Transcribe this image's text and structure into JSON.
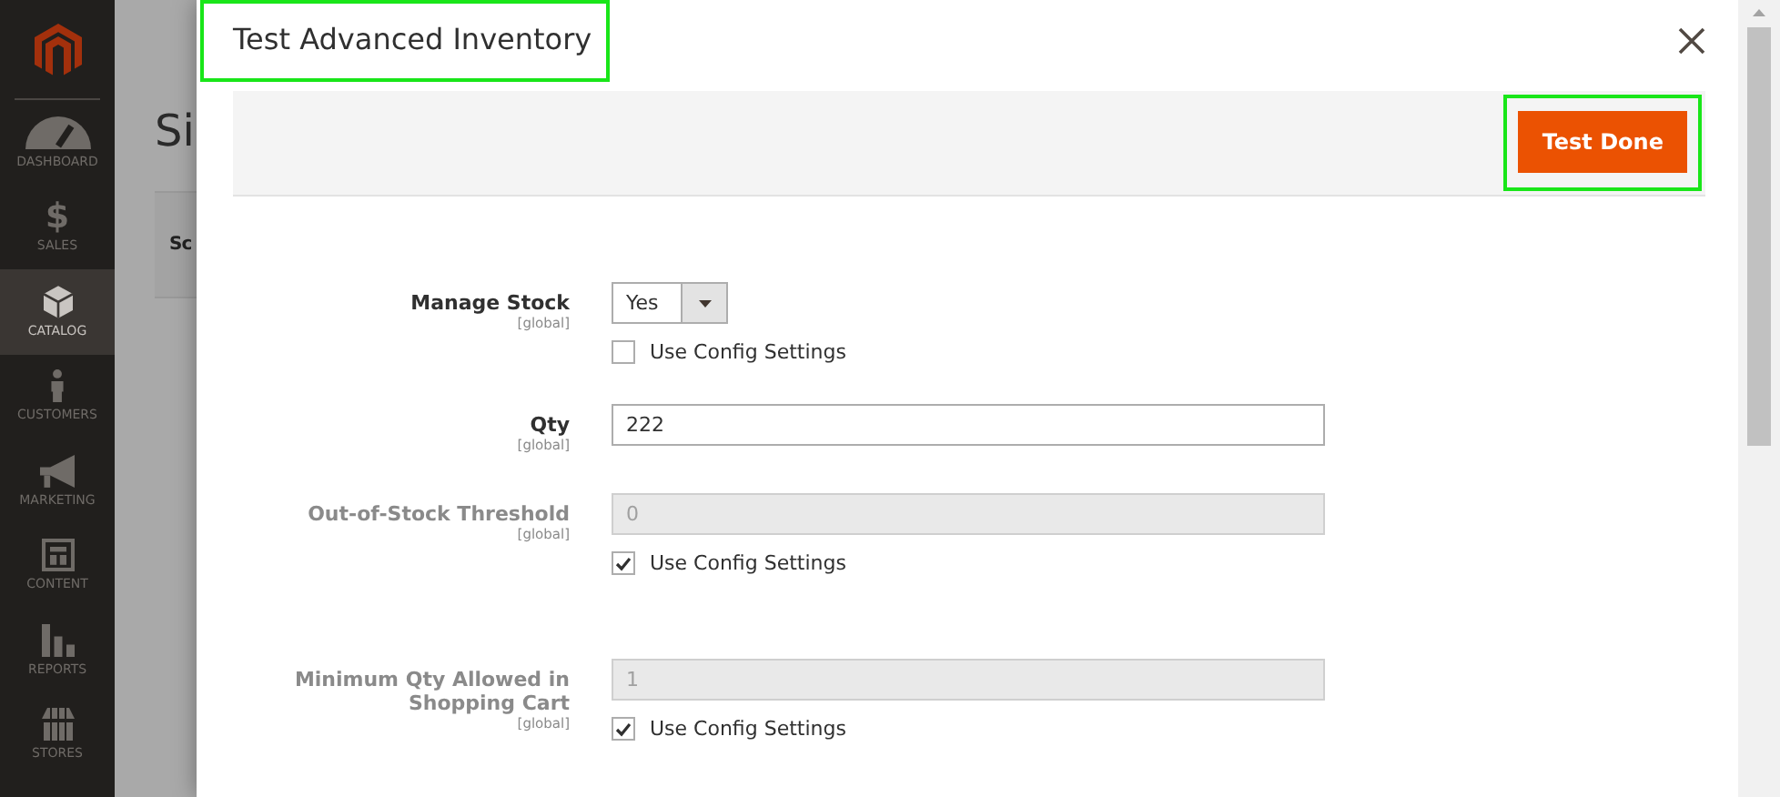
{
  "sidebar": {
    "items": [
      {
        "label": "DASHBOARD",
        "selected": false
      },
      {
        "label": "SALES",
        "icon_text": "$",
        "selected": false
      },
      {
        "label": "CATALOG",
        "selected": true
      },
      {
        "label": "CUSTOMERS",
        "selected": false
      },
      {
        "label": "MARKETING",
        "selected": false
      },
      {
        "label": "CONTENT",
        "selected": false
      },
      {
        "label": "REPORTS",
        "selected": false
      },
      {
        "label": "STORES",
        "selected": false
      }
    ]
  },
  "page": {
    "title": "Si",
    "tab": "Sc"
  },
  "modal": {
    "title": "Test Advanced Inventory",
    "button": "Test Done",
    "fields": [
      {
        "kind": "select",
        "label": "Manage Stock",
        "scope": "[global]",
        "value": "Yes",
        "disabled": false,
        "use_config": {
          "label": "Use Config Settings",
          "checked": false
        }
      },
      {
        "kind": "text",
        "label": "Qty",
        "scope": "[global]",
        "value": "222",
        "disabled": false
      },
      {
        "kind": "text",
        "label": "Out-of-Stock Threshold",
        "scope": "[global]",
        "value": "0",
        "disabled": true,
        "use_config": {
          "label": "Use Config Settings",
          "checked": true
        }
      },
      {
        "kind": "text",
        "label": "Minimum Qty Allowed in Shopping Cart",
        "scope": "[global]",
        "value": "1",
        "disabled": true,
        "use_config": {
          "label": "Use Config Settings",
          "checked": true
        }
      }
    ]
  }
}
